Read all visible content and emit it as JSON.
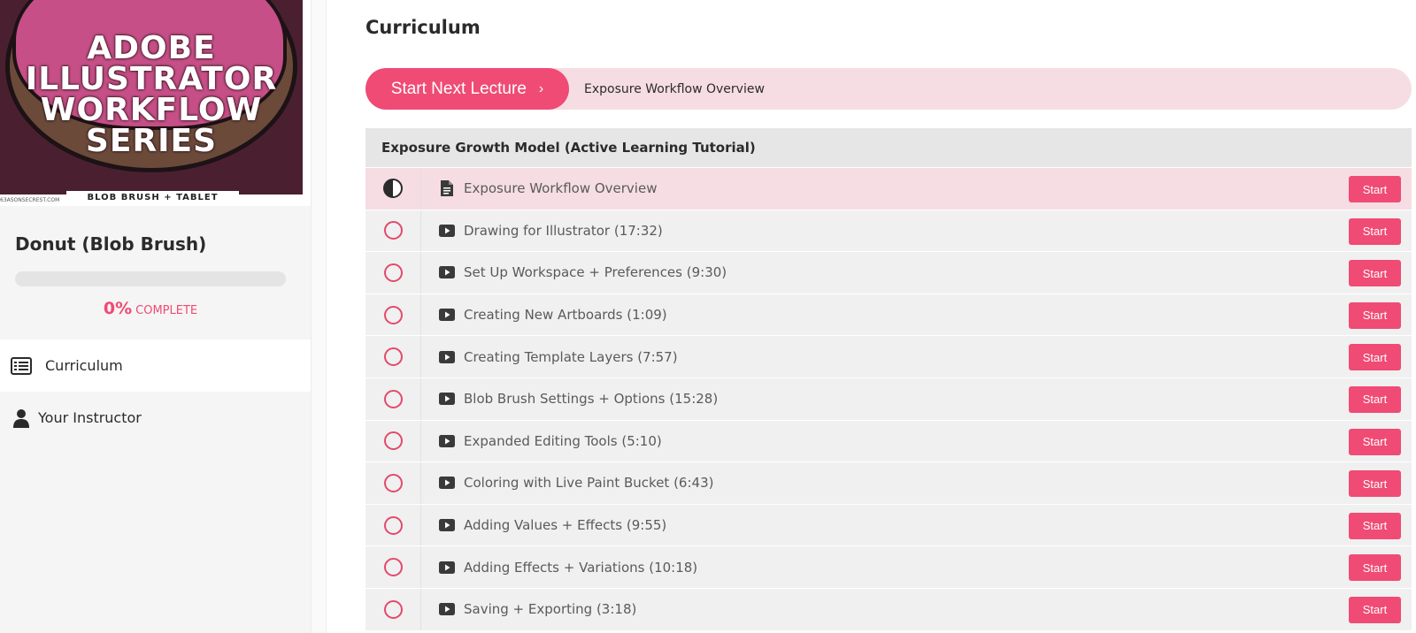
{
  "course": {
    "image_title_lines": [
      "ADOBE",
      "ILLUSTRATOR",
      "WORKFLOW",
      "SERIES"
    ],
    "image_banner": "BLOB BRUSH + TABLET",
    "image_credit": "63ASONSECREST.COM",
    "title": "Donut (Blob Brush)",
    "progress_percent": 0,
    "progress_pct_label": "0%",
    "progress_label": "COMPLETE"
  },
  "sidebar": {
    "items": [
      {
        "label": "Curriculum",
        "icon": "list-icon",
        "active": true
      },
      {
        "label": "Your Instructor",
        "icon": "user-icon",
        "active": false
      }
    ]
  },
  "main": {
    "title": "Curriculum",
    "next_button_label": "Start Next Lecture",
    "next_lecture_title": "Exposure Workflow Overview",
    "section_title": "Exposure Growth Model (Active Learning Tutorial)",
    "start_label": "Start",
    "lectures": [
      {
        "title": "Exposure Workflow Overview",
        "type": "document-icon",
        "status": "half-circle-icon",
        "current": true
      },
      {
        "title": "Drawing for Illustrator (17:32)",
        "type": "video-icon",
        "status": "empty-circle-icon",
        "current": false
      },
      {
        "title": "Set Up Workspace + Preferences (9:30)",
        "type": "video-icon",
        "status": "empty-circle-icon",
        "current": false
      },
      {
        "title": "Creating New Artboards (1:09)",
        "type": "video-icon",
        "status": "empty-circle-icon",
        "current": false
      },
      {
        "title": "Creating Template Layers (7:57)",
        "type": "video-icon",
        "status": "empty-circle-icon",
        "current": false
      },
      {
        "title": "Blob Brush Settings + Options (15:28)",
        "type": "video-icon",
        "status": "empty-circle-icon",
        "current": false
      },
      {
        "title": "Expanded Editing Tools (5:10)",
        "type": "video-icon",
        "status": "empty-circle-icon",
        "current": false
      },
      {
        "title": "Coloring with Live Paint Bucket (6:43)",
        "type": "video-icon",
        "status": "empty-circle-icon",
        "current": false
      },
      {
        "title": "Adding Values + Effects (9:55)",
        "type": "video-icon",
        "status": "empty-circle-icon",
        "current": false
      },
      {
        "title": "Adding Effects + Variations (10:18)",
        "type": "video-icon",
        "status": "empty-circle-icon",
        "current": false
      },
      {
        "title": "Saving + Exporting (3:18)",
        "type": "video-icon",
        "status": "empty-circle-icon",
        "current": false
      }
    ]
  },
  "colors": {
    "accent": "#ef4b74",
    "accent_light": "#f6dde3",
    "row_bg": "#f0f0f0",
    "section_bg": "#e6e6e6"
  }
}
